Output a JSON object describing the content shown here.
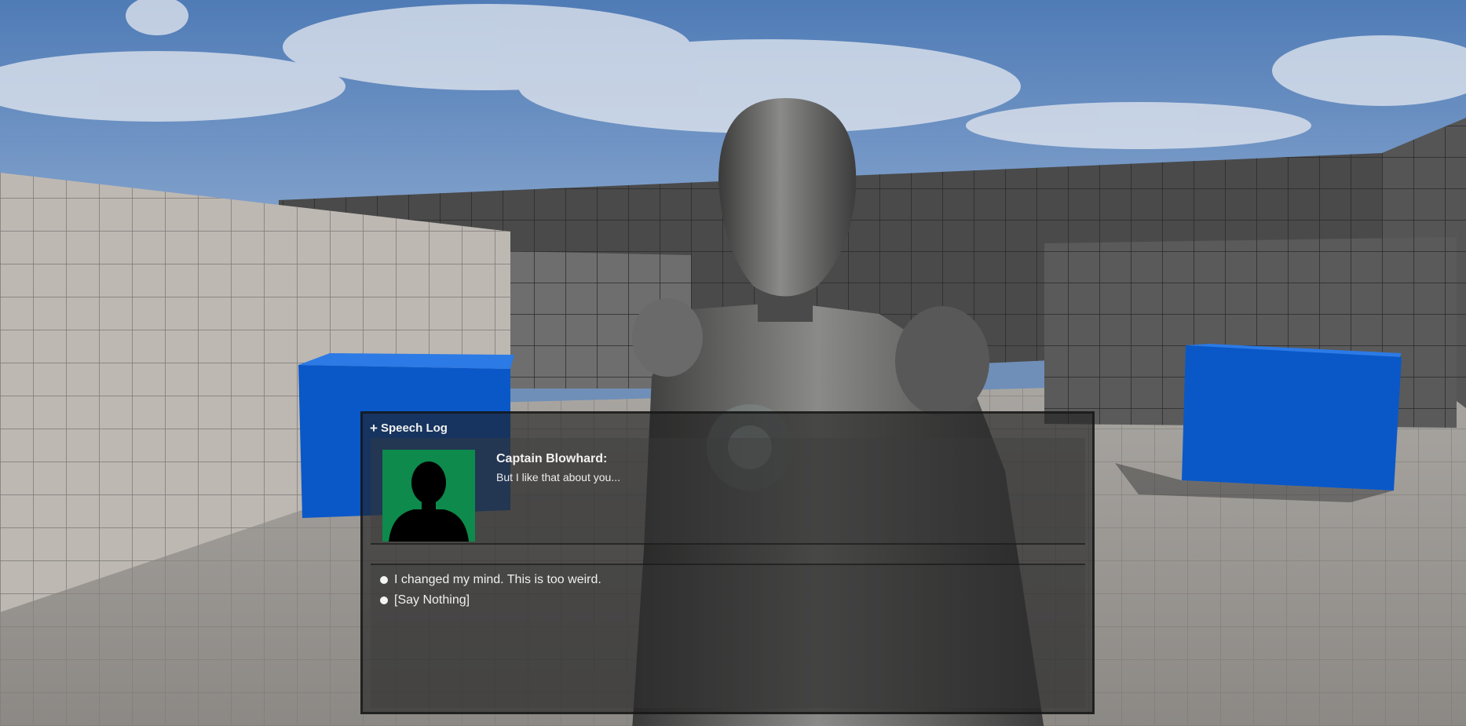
{
  "speech_log": {
    "header_label": "Speech Log",
    "header_icon": "plus-icon"
  },
  "current_line": {
    "speaker": "Captain Blowhard:",
    "text": "But I like that about you...",
    "portrait_icon": "silhouette-icon",
    "portrait_bg": "#0d8a4c"
  },
  "choices": [
    {
      "label": "I changed my mind. This is too weird."
    },
    {
      "label": "[Say Nothing]"
    }
  ],
  "colors": {
    "sky": "#6f8fb8",
    "cube": "#0a58c8",
    "robot": "#5e5e5e"
  }
}
